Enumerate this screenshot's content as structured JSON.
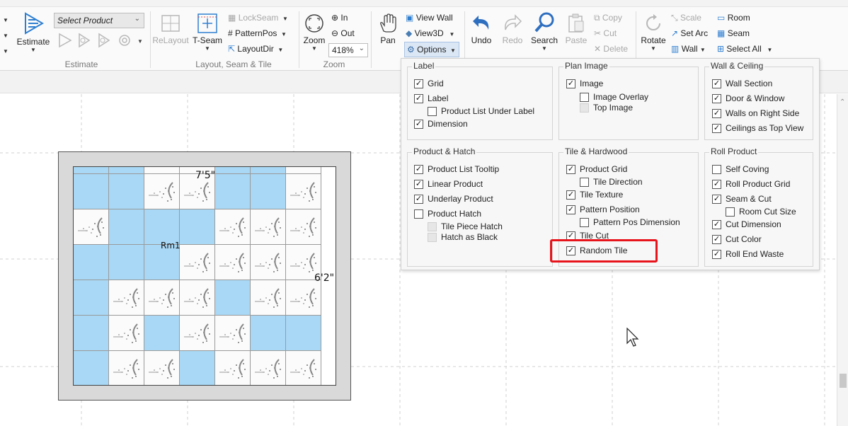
{
  "ribbon": {
    "estimate": {
      "label": "Estimate",
      "group": "Estimate",
      "select_product": "Select Product"
    },
    "layout": {
      "relayout": "ReLayout",
      "tseam": "T-Seam",
      "lockseam": "LockSeam",
      "patternpos": "PatternPos",
      "layoutdir": "LayoutDir",
      "group": "Layout, Seam & Tile"
    },
    "zoom": {
      "label": "Zoom",
      "in": "In",
      "out": "Out",
      "value": "418%",
      "group": "Zoom"
    },
    "view": {
      "pan": "Pan",
      "view_wall": "View Wall",
      "view3d": "View3D",
      "options": "Options"
    },
    "edit": {
      "undo": "Undo",
      "redo": "Redo",
      "search": "Search",
      "paste": "Paste",
      "copy": "Copy",
      "cut": "Cut",
      "delete": "Delete",
      "rotate": "Rotate"
    },
    "draw": {
      "scale": "Scale",
      "set_arc": "Set Arc",
      "wall": "Wall",
      "room": "Room",
      "seam": "Seam",
      "select_all": "Select All"
    }
  },
  "canvas": {
    "room_name": "Rm1",
    "dim_top": "7'5\"",
    "dim_right": "6'2\"",
    "tile_pattern": [
      [
        1,
        1,
        0,
        0,
        1,
        1,
        0
      ],
      [
        1,
        1,
        0,
        0,
        1,
        1,
        0
      ],
      [
        0,
        1,
        1,
        1,
        0,
        0,
        0
      ],
      [
        1,
        1,
        1,
        0,
        0,
        0,
        0
      ],
      [
        1,
        0,
        0,
        0,
        1,
        0,
        0
      ],
      [
        1,
        0,
        1,
        0,
        0,
        1,
        1
      ],
      [
        1,
        0,
        0,
        1,
        0,
        0,
        0
      ]
    ]
  },
  "options_panel": {
    "label": {
      "title": "Label",
      "grid": "Grid",
      "label": "Label",
      "product_list_under_label": "Product List Under Label",
      "dimension": "Dimension"
    },
    "plan_image": {
      "title": "Plan Image",
      "image": "Image",
      "image_overlay": "Image Overlay",
      "top_image": "Top Image"
    },
    "wall_ceiling": {
      "title": "Wall & Ceiling",
      "wall_section": "Wall Section",
      "door_window": "Door & Window",
      "walls_on_right_side": "Walls on Right Side",
      "ceilings_as_top_view": "Ceilings as Top View"
    },
    "product_hatch": {
      "title": "Product & Hatch",
      "product_list_tooltip": "Product List Tooltip",
      "linear_product": "Linear Product",
      "underlay_product": "Underlay Product",
      "product_hatch": "Product Hatch",
      "tile_piece_hatch": "Tile Piece Hatch",
      "hatch_as_black": "Hatch as Black"
    },
    "tile_hardwood": {
      "title": "Tile & Hardwood",
      "product_grid": "Product Grid",
      "tile_direction": "Tile Direction",
      "tile_texture": "Tile Texture",
      "pattern_position": "Pattern Position",
      "pattern_pos_dimension": "Pattern Pos Dimension",
      "tile_cut": "Tile Cut",
      "random_tile": "Random Tile"
    },
    "roll_product": {
      "title": "Roll Product",
      "self_coving": "Self Coving",
      "roll_product_grid": "Roll Product Grid",
      "seam_cut": "Seam & Cut",
      "room_cut_size": "Room Cut Size",
      "cut_dimension": "Cut Dimension",
      "cut_color": "Cut Color",
      "roll_end_waste": "Roll End Waste"
    }
  },
  "colors": {
    "highlight": "#e8141c",
    "tile_blue": "#a8d8f5",
    "options_active": "#dbe7f5"
  }
}
